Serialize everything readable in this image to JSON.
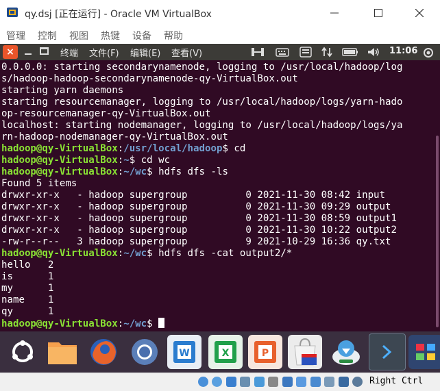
{
  "window": {
    "title": "qy.dsj [正在运行] - Oracle VM VirtualBox"
  },
  "vbox_menu": [
    "管理",
    "控制",
    "视图",
    "热键",
    "设备",
    "帮助"
  ],
  "panel": {
    "menus": [
      "终端",
      "文件(F)",
      "编辑(E)",
      "查看(V)"
    ],
    "clock": "11:06"
  },
  "terminal": {
    "lines": [
      [
        {
          "t": "0.0.0.0: starting secondarynamenode, logging to /usr/local/hadoop/log"
        }
      ],
      [
        {
          "t": "s/hadoop-hadoop-secondarynamenode-qy-VirtualBox.out"
        }
      ],
      [
        {
          "t": "starting yarn daemons"
        }
      ],
      [
        {
          "t": "starting resourcemanager, logging to /usr/local/hadoop/logs/yarn-hado"
        }
      ],
      [
        {
          "t": "op-resourcemanager-qy-VirtualBox.out"
        }
      ],
      [
        {
          "t": "localhost: starting nodemanager, logging to /usr/local/hadoop/logs/ya"
        }
      ],
      [
        {
          "t": "rn-hadoop-nodemanager-qy-VirtualBox.out"
        }
      ],
      [
        {
          "t": "hadoop@qy-VirtualBox",
          "c": "u"
        },
        {
          "t": ":"
        },
        {
          "t": "/usr/local/hadoop",
          "c": "p"
        },
        {
          "t": "$ cd"
        }
      ],
      [
        {
          "t": "hadoop@qy-VirtualBox",
          "c": "u"
        },
        {
          "t": ":"
        },
        {
          "t": "~",
          "c": "p"
        },
        {
          "t": "$ cd wc"
        }
      ],
      [
        {
          "t": "hadoop@qy-VirtualBox",
          "c": "u"
        },
        {
          "t": ":"
        },
        {
          "t": "~/wc",
          "c": "p"
        },
        {
          "t": "$ hdfs dfs -ls"
        }
      ],
      [
        {
          "t": "Found 5 items"
        }
      ],
      [
        {
          "t": "drwxr-xr-x   - hadoop supergroup          0 2021-11-30 08:42 input"
        }
      ],
      [
        {
          "t": "drwxr-xr-x   - hadoop supergroup          0 2021-11-30 09:29 output"
        }
      ],
      [
        {
          "t": "drwxr-xr-x   - hadoop supergroup          0 2021-11-30 08:59 output1"
        }
      ],
      [
        {
          "t": "drwxr-xr-x   - hadoop supergroup          0 2021-11-30 10:22 output2"
        }
      ],
      [
        {
          "t": "-rw-r--r--   3 hadoop supergroup          9 2021-10-29 16:36 qy.txt"
        }
      ],
      [
        {
          "t": "hadoop@qy-VirtualBox",
          "c": "u"
        },
        {
          "t": ":"
        },
        {
          "t": "~/wc",
          "c": "p"
        },
        {
          "t": "$ hdfs dfs -cat output2/*"
        }
      ],
      [
        {
          "t": "hello   2"
        }
      ],
      [
        {
          "t": "is      1"
        }
      ],
      [
        {
          "t": "my      1"
        }
      ],
      [
        {
          "t": "name    1"
        }
      ],
      [
        {
          "t": "qy      1"
        }
      ],
      [
        {
          "t": "hadoop@qy-VirtualBox",
          "c": "u"
        },
        {
          "t": ":"
        },
        {
          "t": "~/wc",
          "c": "p"
        },
        {
          "t": "$ "
        }
      ]
    ]
  },
  "dock": [
    {
      "name": "ubuntu-dash-icon",
      "color": "#7a3f8a"
    },
    {
      "name": "files-icon",
      "color": "#f6a04d"
    },
    {
      "name": "firefox-icon",
      "color": "#e8632b"
    },
    {
      "name": "chromium-icon",
      "color": "#4a6fae"
    },
    {
      "name": "writer-icon",
      "color": "#2a7ccf"
    },
    {
      "name": "calc-icon",
      "color": "#20a04a"
    },
    {
      "name": "impress-icon",
      "color": "#e8602c"
    },
    {
      "name": "software-center-icon",
      "color": "#e0e0e0"
    },
    {
      "name": "update-manager-icon",
      "color": "#dfe6ea"
    },
    {
      "name": "terminal-launcher-icon",
      "color": "#3d4752"
    },
    {
      "name": "workspace-switcher-icon",
      "color": "#2f4570"
    }
  ],
  "statusbar": {
    "host_key": "Right Ctrl"
  }
}
